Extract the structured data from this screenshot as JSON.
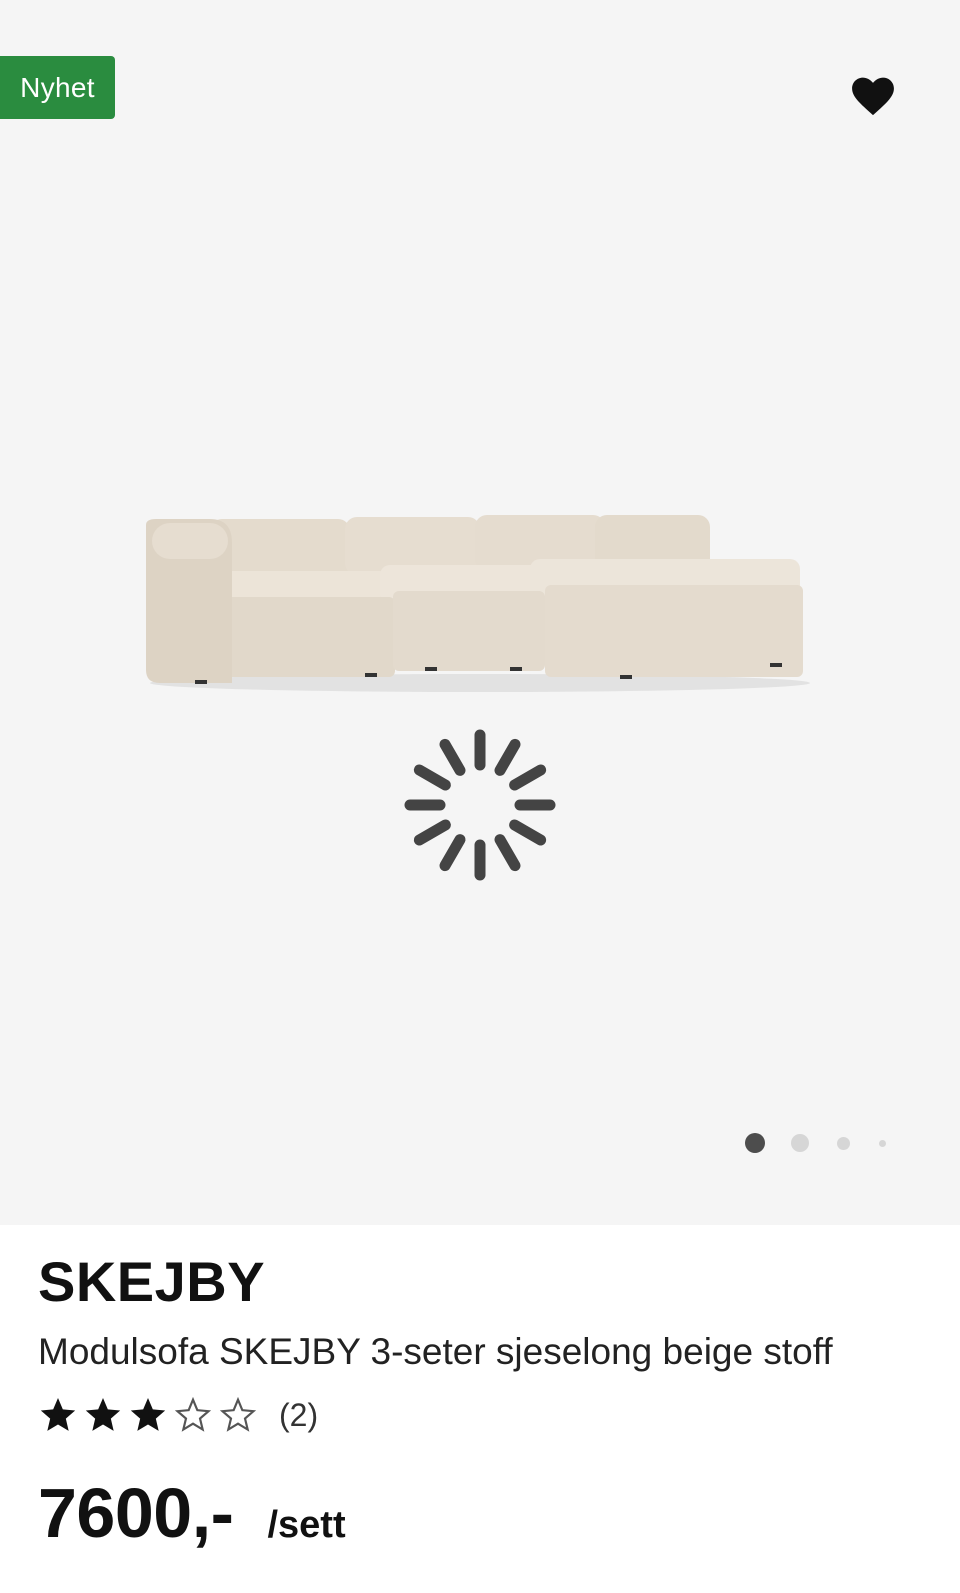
{
  "gallery": {
    "badge": "Nyhet",
    "favorite_icon": "heart-icon",
    "loading_icon": "spinner-icon",
    "current_slide": 1,
    "slide_count": 4,
    "colors": {
      "badge": "#2a8c3f",
      "background": "#f5f5f5",
      "sofa": "#e6ddd0"
    }
  },
  "product": {
    "brand": "SKEJBY",
    "description": "Modulsofa SKEJBY 3-seter sjeselong beige stoff",
    "rating": {
      "stars": 3,
      "max": 5,
      "count": "(2)"
    },
    "price": "7600,-",
    "unit": "/sett"
  }
}
